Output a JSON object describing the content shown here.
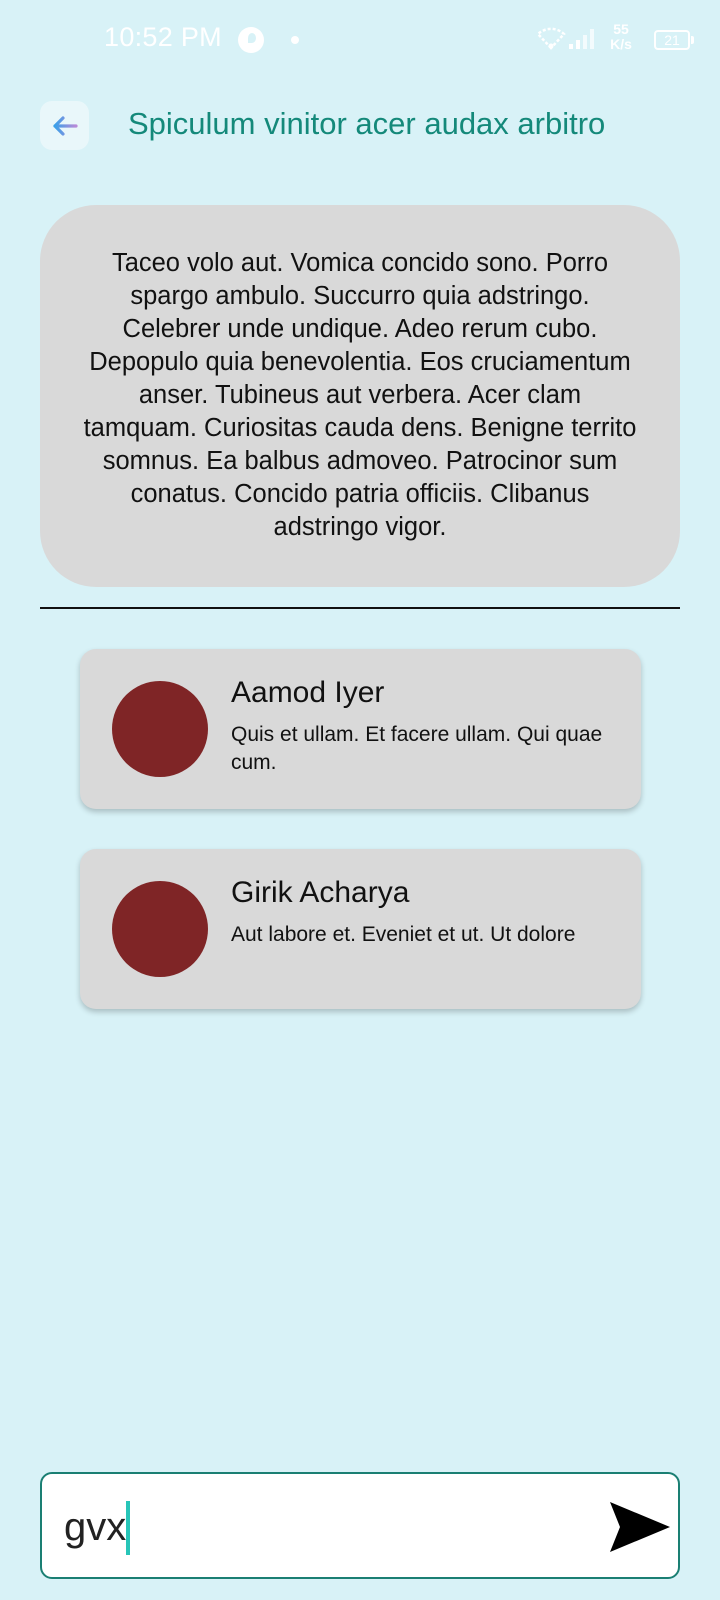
{
  "status_bar": {
    "time": "10:52 PM",
    "net_speed_value": "55",
    "net_speed_unit": "K/s",
    "battery": "21",
    "icons": [
      "app-notification-icon",
      "wifi-icon",
      "signal-icon",
      "battery-icon"
    ]
  },
  "header": {
    "back_icon": "arrow-left-icon",
    "title": "Spiculum vinitor acer audax arbitro"
  },
  "description": {
    "text": "Taceo volo aut. Vomica concido sono. Porro spargo ambulo. Succurro quia adstringo. Celebrer unde undique. Adeo rerum cubo. Depopulo quia benevolentia. Eos cruciamentum anser. Tubineus aut verbera. Acer clam tamquam. Curiositas cauda dens. Benigne territo somnus. Ea balbus admoveo. Patrocinor sum conatus. Concido patria officiis. Clibanus adstringo vigor."
  },
  "members": [
    {
      "name": "Aamod Iyer",
      "message": "Quis et ullam. Et facere ullam. Qui quae cum."
    },
    {
      "name": "Girik Acharya",
      "message": "Aut labore et. Eveniet et ut. Ut dolore"
    }
  ],
  "composer": {
    "value": "gvx",
    "send_icon": "send-icon"
  },
  "colors": {
    "background": "#d8f2f7",
    "accent": "#14897a",
    "card": "#d9d9d9",
    "avatar": "#7f2526",
    "input_border": "#1a7f73",
    "caret": "#27c5b8"
  }
}
